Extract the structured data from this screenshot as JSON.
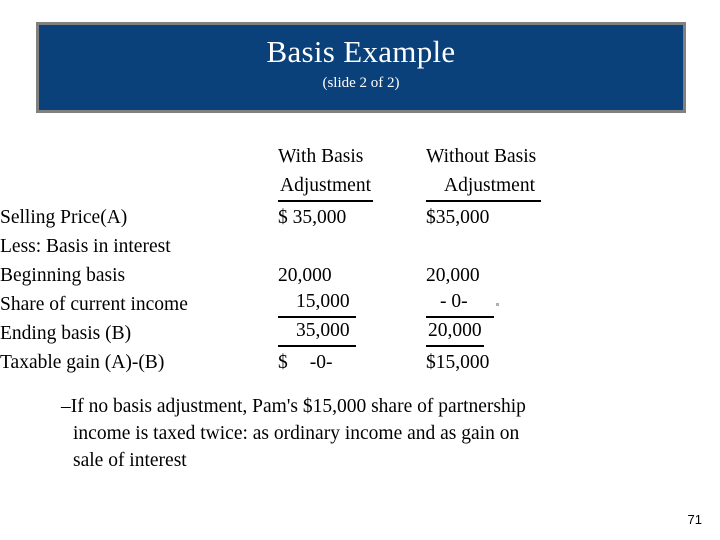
{
  "slide": {
    "title": "Basis Example",
    "subtitle": "(slide 2 of 2)",
    "page_number": "71",
    "banner_color": "#0a417a",
    "banner_border_color": "#808080",
    "title_color": "#ffffff"
  },
  "table": {
    "columns": [
      {
        "line1": "With Basis",
        "line2": "Adjustment"
      },
      {
        "line1": "Without Basis",
        "line2": "Adjustment"
      }
    ],
    "rows": [
      {
        "label": "Selling Price(A)",
        "col1": "$ 35,000",
        "col2": "$35,000"
      },
      {
        "label": "Less: Basis in interest",
        "col1": "",
        "col2": ""
      },
      {
        "label": "Beginning basis",
        "col1": "20,000",
        "col2": "20,000"
      },
      {
        "label": "Share of current income",
        "col1": "15,000",
        "col2": "- 0-"
      },
      {
        "label": "Ending basis (B)",
        "col1": "35,000",
        "col2": "20,000"
      },
      {
        "label": "Taxable gain (A)-(B)",
        "col1": "$",
        "col1b": "-0-",
        "col2": "$15,000"
      }
    ]
  },
  "bullet": {
    "dash": "–",
    "line1": "If no basis adjustment, Pam's $15,000 share of partnership",
    "line2": "income is taxed twice: as ordinary income and as gain on",
    "line3": "sale of interest"
  }
}
